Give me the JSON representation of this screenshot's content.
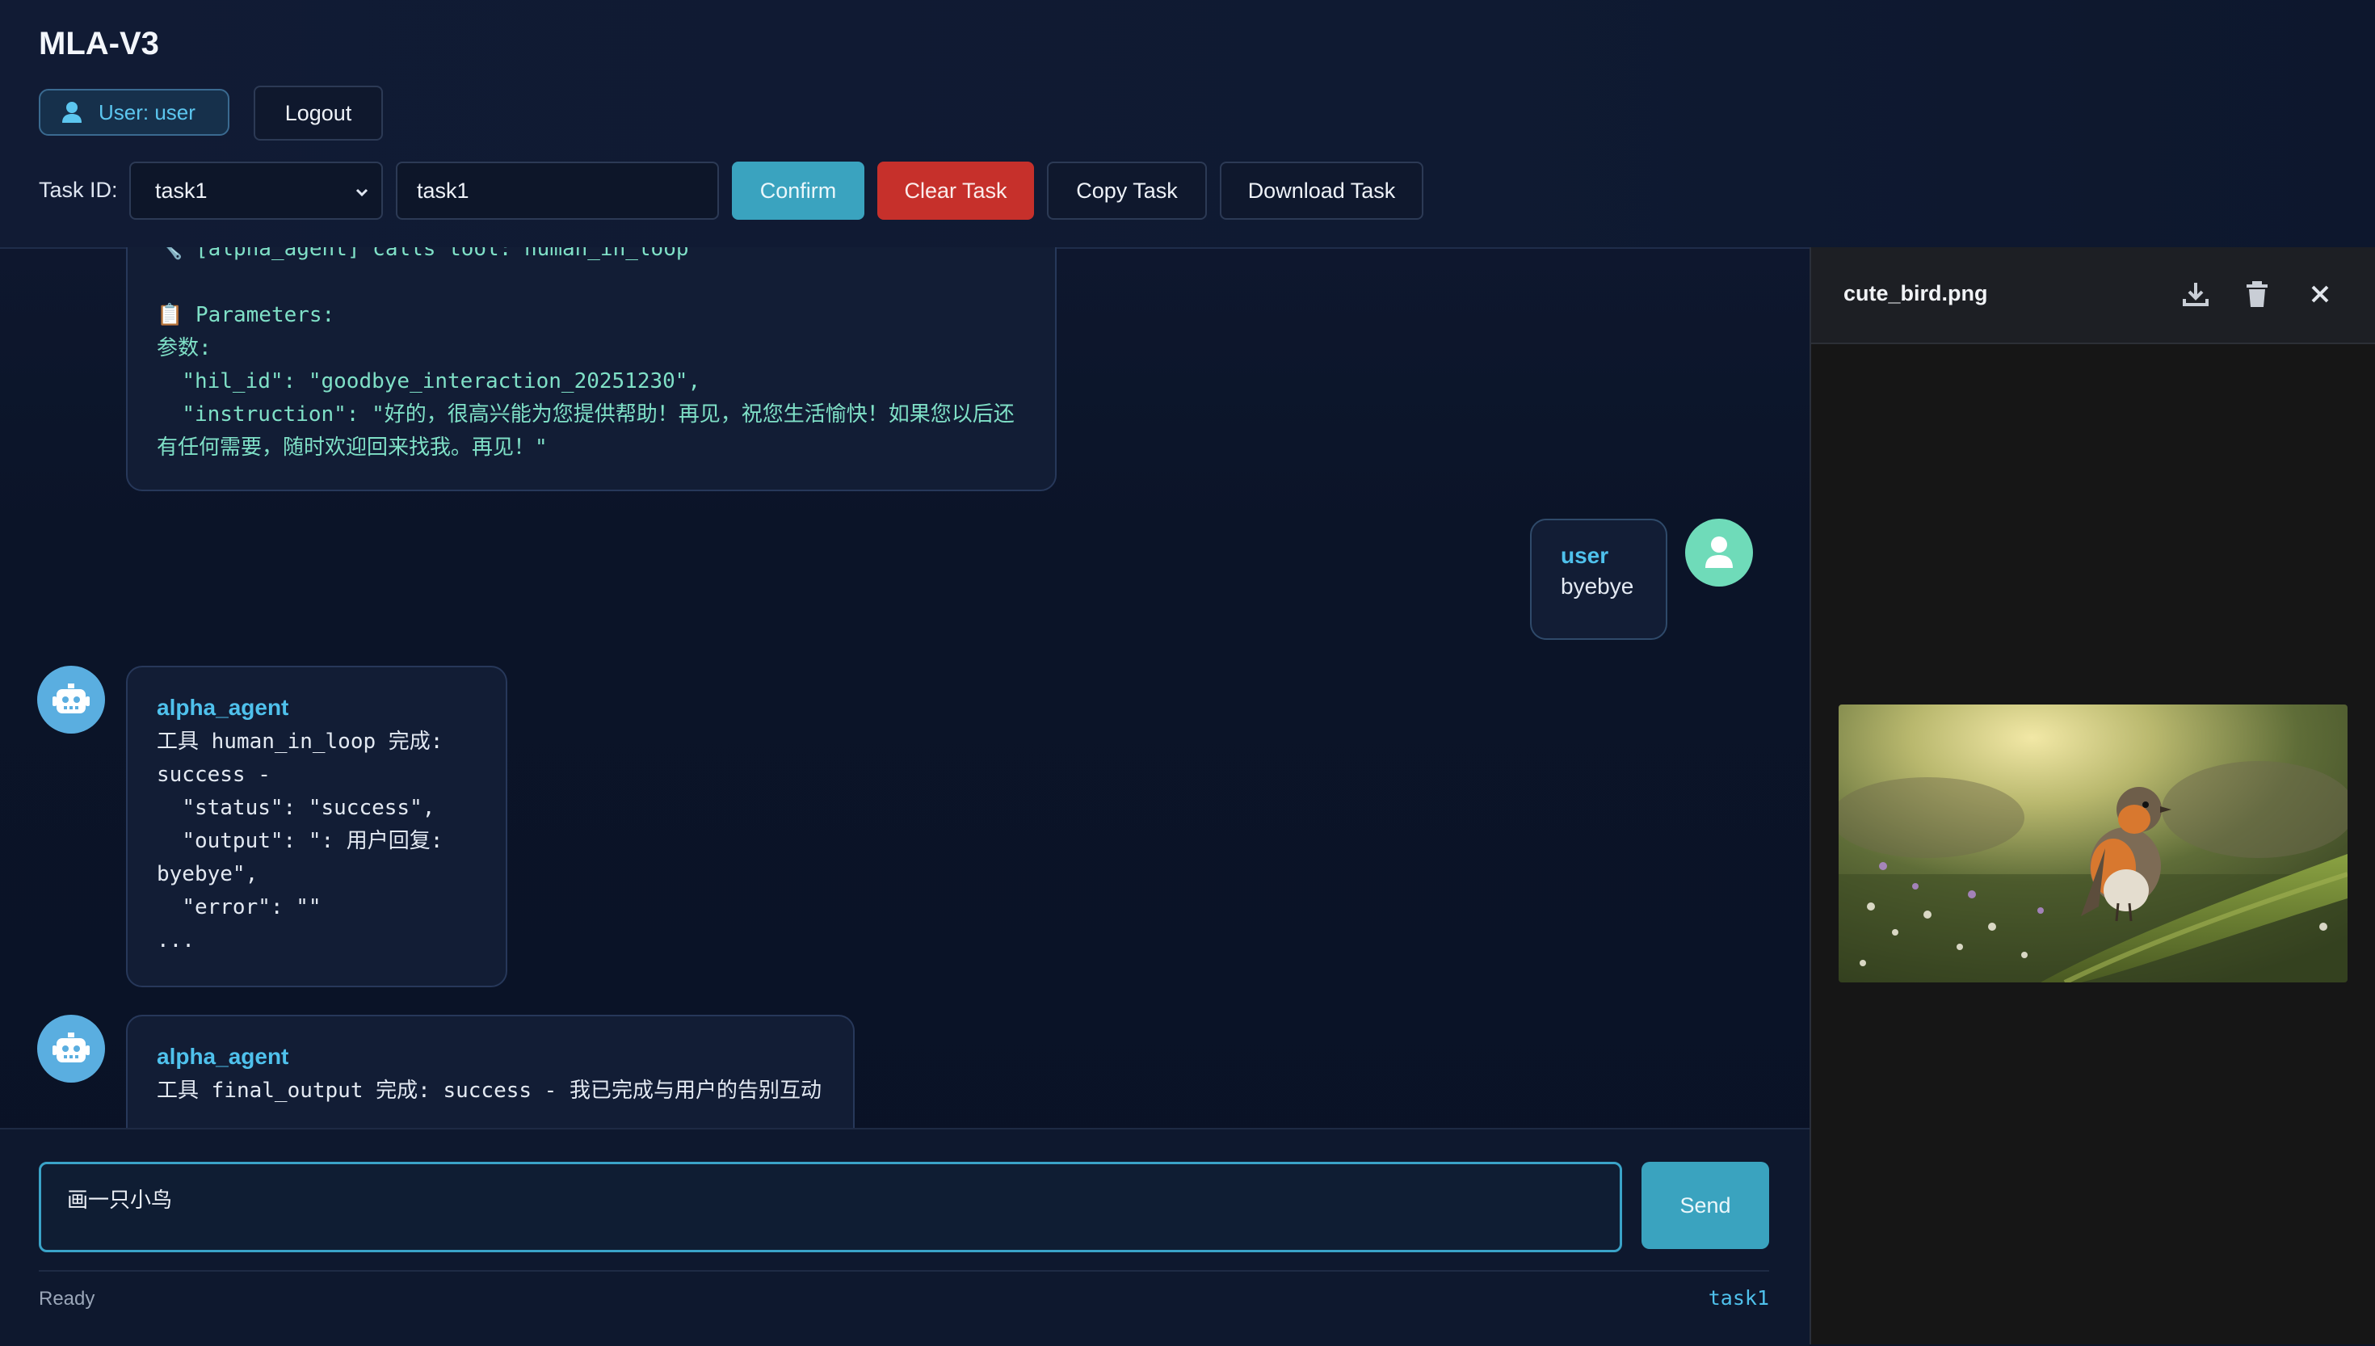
{
  "header": {
    "title": "MLA-V3",
    "user_label": "User: user",
    "logout_label": "Logout",
    "task_id_label": "Task ID:",
    "task_select_value": "task1",
    "task_input_value": "task1",
    "confirm_label": "Confirm",
    "clear_label": "Clear Task",
    "copy_label": "Copy Task",
    "download_label": "Download Task"
  },
  "messages": [
    {
      "tool_call_line": "🔧 [alpha_agent] calls tool: human_in_loop",
      "parameters_line": "📋 Parameters:",
      "params_cn": "参数:",
      "hil_id_line": "  \"hil_id\": \"goodbye_interaction_20251230\",",
      "instruction_line": "  \"instruction\": \"好的，很高兴能为您提供帮助！再见，祝您生活愉快！如果您以后还有任何需要，随时欢迎回来找我。再见！\""
    },
    {
      "sender": "user",
      "text": "byebye"
    },
    {
      "sender": "alpha_agent",
      "lines": [
        "工具 human_in_loop 完成:",
        "success -",
        "  \"status\": \"success\",",
        "  \"output\": \": 用户回复:",
        "byebye\",",
        "  \"error\": \"\"",
        "..."
      ]
    },
    {
      "sender": "alpha_agent",
      "text": "工具 final_output 完成: success - 我已完成与用户的告别互动"
    }
  ],
  "composer": {
    "input_value": "画一只小鸟",
    "send_label": "Send",
    "status": "Ready",
    "current_task": "task1"
  },
  "preview": {
    "filename": "cute_bird.png",
    "icons": [
      "download-icon",
      "trash-icon",
      "close-icon"
    ]
  },
  "colors": {
    "accent": "#4fc1ec",
    "confirm": "#3aa3bf",
    "danger": "#c6302b",
    "user_avatar": "#6fdbb9",
    "agent_avatar": "#5aaee0"
  }
}
